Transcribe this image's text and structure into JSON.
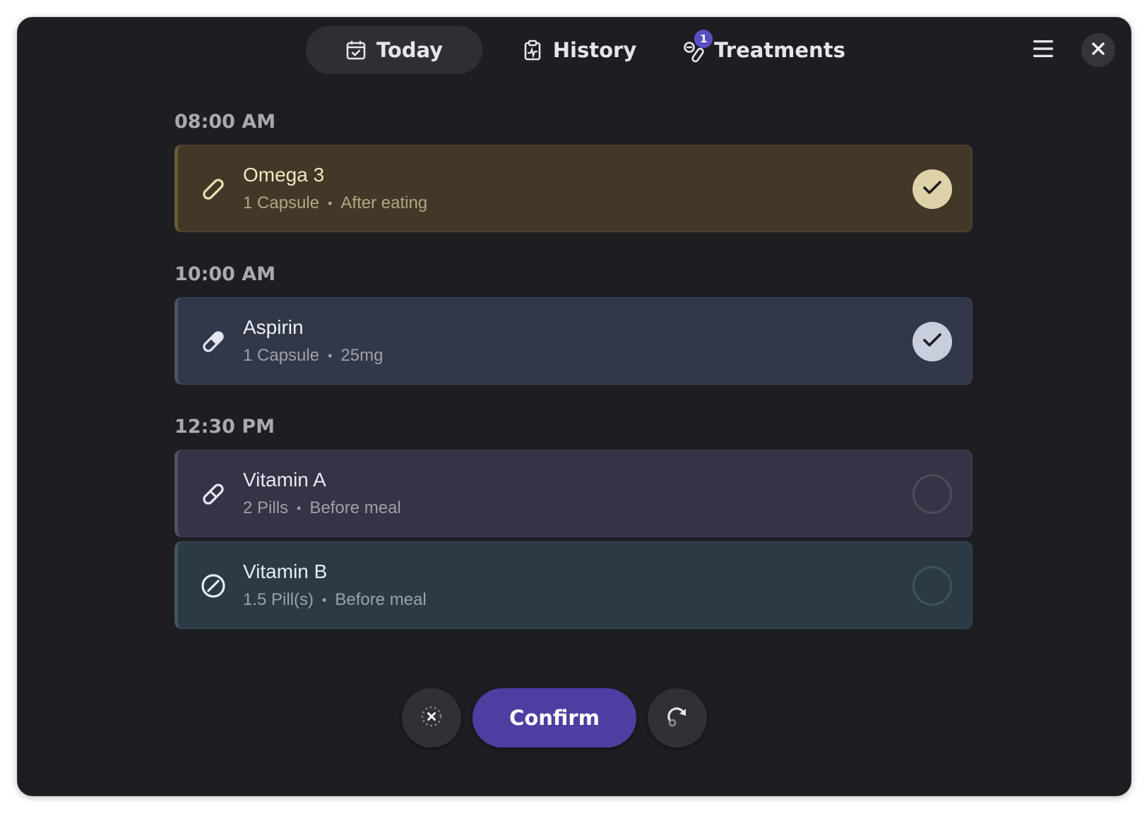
{
  "tabs": [
    {
      "label": "Today",
      "icon": "calendar-check-icon",
      "active": true
    },
    {
      "label": "History",
      "icon": "clipboard-chart-icon",
      "active": false
    },
    {
      "label": "Treatments",
      "icon": "pills-icon",
      "active": false,
      "badge": "1"
    }
  ],
  "header": {
    "menu_icon": "hamburger-menu-icon",
    "close_icon": "close-icon"
  },
  "schedule": [
    {
      "time": "08:00 AM",
      "meds": [
        {
          "name": "Omega 3",
          "amount": "1 Capsule",
          "note": "After eating",
          "icon": "capsule-outline-icon",
          "taken": true
        }
      ]
    },
    {
      "time": "10:00 AM",
      "meds": [
        {
          "name": "Aspirin",
          "amount": "1 Capsule",
          "note": "25mg",
          "icon": "capsule-half-icon",
          "taken": true
        }
      ]
    },
    {
      "time": "12:30 PM",
      "meds": [
        {
          "name": "Vitamin A",
          "amount": "2 Pills",
          "note": "Before meal",
          "icon": "capsule-line-icon",
          "taken": false
        },
        {
          "name": "Vitamin B",
          "amount": "1.5 Pill(s)",
          "note": "Before meal",
          "icon": "tablet-icon",
          "taken": false
        }
      ]
    }
  ],
  "separator": "•",
  "footer": {
    "confirm_label": "Confirm",
    "skip_icon": "skip-dose-icon",
    "snooze_icon": "snooze-later-icon"
  },
  "colors": {
    "accent": "#4d3ea1",
    "badge": "#5a4fc0",
    "background": "#1d1d22"
  }
}
